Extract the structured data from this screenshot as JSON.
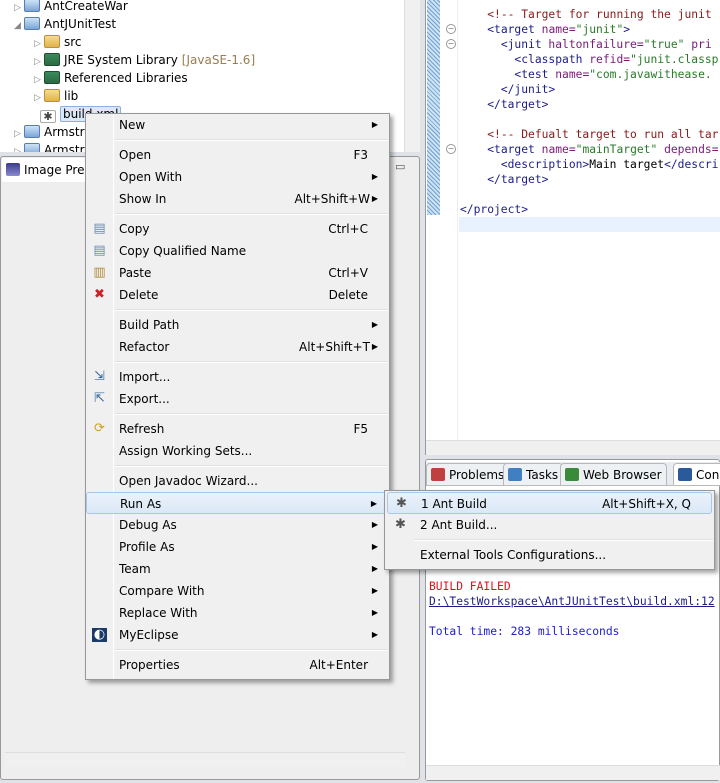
{
  "explorer": {
    "items": [
      {
        "label": "AntCreateWar",
        "twisty": "collapsed",
        "icon": "project-icon"
      },
      {
        "label": "AntJUnitTest",
        "twisty": "expanded",
        "icon": "project-icon"
      },
      {
        "label": "src",
        "twisty": "collapsed",
        "icon": "package-folder-icon"
      },
      {
        "label": "JRE System Library",
        "suffix": "[JavaSE-1.6]",
        "twisty": "collapsed",
        "icon": "library-icon"
      },
      {
        "label": "Referenced Libraries",
        "twisty": "collapsed",
        "icon": "library-icon"
      },
      {
        "label": "lib",
        "twisty": "collapsed",
        "icon": "folder-icon"
      },
      {
        "label": "build.xml",
        "icon": "ant-file-icon",
        "selected": true
      },
      {
        "label": "Armstrong",
        "twisty": "collapsed",
        "icon": "project-icon"
      },
      {
        "label": "Armstrong",
        "twisty": "collapsed",
        "icon": "project-icon"
      }
    ]
  },
  "image_preview": {
    "title": "Image Preview"
  },
  "editor": {
    "lines": [
      [
        {
          "t": "    "
        },
        {
          "t": "<!-- Target for running the junit",
          "k": "comment"
        }
      ],
      [
        {
          "t": "    "
        },
        {
          "t": "<target ",
          "k": "tag"
        },
        {
          "t": "name=",
          "k": "attr"
        },
        {
          "t": "\"junit\"",
          "k": "string"
        },
        {
          "t": ">",
          "k": "tag"
        }
      ],
      [
        {
          "t": "      "
        },
        {
          "t": "<junit ",
          "k": "tag"
        },
        {
          "t": "haltonfailure=",
          "k": "attr"
        },
        {
          "t": "\"true\"",
          "k": "string"
        },
        {
          "t": " pri",
          "k": "attr"
        }
      ],
      [
        {
          "t": "        "
        },
        {
          "t": "<classpath ",
          "k": "tag"
        },
        {
          "t": "refid=",
          "k": "attr"
        },
        {
          "t": "\"junit.classp",
          "k": "string"
        }
      ],
      [
        {
          "t": "        "
        },
        {
          "t": "<test ",
          "k": "tag"
        },
        {
          "t": "name=",
          "k": "attr"
        },
        {
          "t": "\"com.javawithease.",
          "k": "string"
        }
      ],
      [
        {
          "t": "      "
        },
        {
          "t": "</junit>",
          "k": "tag"
        }
      ],
      [
        {
          "t": "    "
        },
        {
          "t": "</target>",
          "k": "tag"
        }
      ],
      [
        {
          "t": ""
        }
      ],
      [
        {
          "t": "    "
        },
        {
          "t": "<!-- Defualt target to run all tar",
          "k": "comment"
        }
      ],
      [
        {
          "t": "    "
        },
        {
          "t": "<target ",
          "k": "tag"
        },
        {
          "t": "name=",
          "k": "attr"
        },
        {
          "t": "\"mainTarget\"",
          "k": "string"
        },
        {
          "t": " depends=",
          "k": "attr"
        }
      ],
      [
        {
          "t": "      "
        },
        {
          "t": "<description>",
          "k": "tag"
        },
        {
          "t": "Main target",
          "k": "text"
        },
        {
          "t": "</descri",
          "k": "tag"
        }
      ],
      [
        {
          "t": "    "
        },
        {
          "t": "</target>",
          "k": "tag"
        }
      ],
      [
        {
          "t": ""
        }
      ],
      [
        {
          "t": "</project>",
          "k": "tag"
        }
      ]
    ]
  },
  "bottom_tabs": [
    {
      "label": "Problems",
      "icon": "problems-icon"
    },
    {
      "label": "Tasks",
      "icon": "tasks-icon"
    },
    {
      "label": "Web Browser",
      "icon": "globe-icon"
    },
    {
      "label": "Console",
      "icon": "console-icon",
      "active": true
    }
  ],
  "console": {
    "build_failed": "BUILD FAILED",
    "error_link": "D:\\TestWorkspace\\AntJUnitTest\\build.xml:12",
    "total_time": "Total time: 283 milliseconds",
    "colors": {
      "error": "#e0101a",
      "link": "#1c1c8c",
      "info": "#2020c8"
    }
  },
  "context_menu": {
    "items": [
      {
        "label": "New",
        "submenu": true
      },
      {
        "sep": true
      },
      {
        "label": "Open",
        "shortcut": "F3"
      },
      {
        "label": "Open With",
        "submenu": true
      },
      {
        "label": "Show In",
        "shortcut": "Alt+Shift+W",
        "submenu": true
      },
      {
        "sep": true
      },
      {
        "label": "Copy",
        "shortcut": "Ctrl+C",
        "icon": "copy-icon"
      },
      {
        "label": "Copy Qualified Name",
        "icon": "copy-qualified-icon"
      },
      {
        "label": "Paste",
        "shortcut": "Ctrl+V",
        "icon": "paste-icon"
      },
      {
        "label": "Delete",
        "shortcut": "Delete",
        "icon": "delete-icon"
      },
      {
        "sep": true
      },
      {
        "label": "Build Path",
        "submenu": true
      },
      {
        "label": "Refactor",
        "shortcut": "Alt+Shift+T",
        "submenu": true
      },
      {
        "sep": true
      },
      {
        "label": "Import...",
        "icon": "import-icon"
      },
      {
        "label": "Export...",
        "icon": "export-icon"
      },
      {
        "sep": true
      },
      {
        "label": "Refresh",
        "shortcut": "F5",
        "icon": "refresh-icon"
      },
      {
        "label": "Assign Working Sets..."
      },
      {
        "sep": true
      },
      {
        "label": "Open Javadoc Wizard..."
      },
      {
        "label": "Run As",
        "submenu": true,
        "highlighted": true
      },
      {
        "label": "Debug As",
        "submenu": true
      },
      {
        "label": "Profile As",
        "submenu": true
      },
      {
        "label": "Team",
        "submenu": true
      },
      {
        "label": "Compare With",
        "submenu": true
      },
      {
        "label": "Replace With",
        "submenu": true
      },
      {
        "label": "MyEclipse",
        "submenu": true,
        "icon": "myeclipse-icon"
      },
      {
        "sep": true
      },
      {
        "label": "Properties",
        "shortcut": "Alt+Enter"
      }
    ]
  },
  "run_as_submenu": {
    "items": [
      {
        "label": "1 Ant Build",
        "shortcut": "Alt+Shift+X, Q",
        "icon": "ant-icon",
        "highlighted": true
      },
      {
        "label": "2 Ant Build...",
        "icon": "ant-icon"
      },
      {
        "sep": true
      },
      {
        "label": "External Tools Configurations..."
      }
    ]
  }
}
